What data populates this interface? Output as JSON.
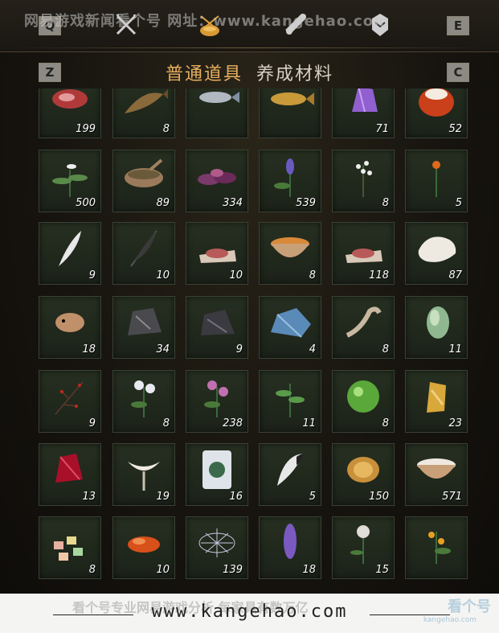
{
  "header": {
    "watermark": "网易游戏新闻看个号 网址：www.kangehao.com",
    "key_left": "Q",
    "key_right": "E",
    "key_sub_left": "Z",
    "key_sub_right": "C",
    "tabs": [
      {
        "icon": "crossed-swords-icon"
      },
      {
        "icon": "bag-icon",
        "active": true
      },
      {
        "icon": "scroll-icon"
      },
      {
        "icon": "badge-icon"
      }
    ]
  },
  "subtabs": [
    {
      "label": "普通道具",
      "active": true
    },
    {
      "label": "养成材料",
      "active": false
    }
  ],
  "items": [
    {
      "icon": "meat-icon",
      "qty": "199"
    },
    {
      "icon": "fish-brown-icon",
      "qty": "8"
    },
    {
      "icon": "fish-silver-icon",
      "qty": ""
    },
    {
      "icon": "fish-gold-icon",
      "qty": ""
    },
    {
      "icon": "amethyst-icon",
      "qty": "71"
    },
    {
      "icon": "amber-orange-icon",
      "qty": "52"
    },
    {
      "icon": "herb-white-flower-icon",
      "qty": "500"
    },
    {
      "icon": "mortar-icon",
      "qty": "89"
    },
    {
      "icon": "purple-leaf-icon",
      "qty": "334"
    },
    {
      "icon": "lavender-icon",
      "qty": "539"
    },
    {
      "icon": "baby-breath-icon",
      "qty": "8"
    },
    {
      "icon": "orange-flower-icon",
      "qty": "5"
    },
    {
      "icon": "feather-icon",
      "qty": "9"
    },
    {
      "icon": "dark-feather-icon",
      "qty": "10"
    },
    {
      "icon": "raw-meat-icon",
      "qty": "10"
    },
    {
      "icon": "broth-bowl-icon",
      "qty": "8"
    },
    {
      "icon": "raw-meat-icon",
      "qty": "118"
    },
    {
      "icon": "fur-pelt-icon",
      "qty": "87"
    },
    {
      "icon": "pufferfish-icon",
      "qty": "18"
    },
    {
      "icon": "iron-ore-icon",
      "qty": "34"
    },
    {
      "icon": "dark-ore-icon",
      "qty": "9"
    },
    {
      "icon": "blue-crystal-icon",
      "qty": "4"
    },
    {
      "icon": "bone-icon",
      "qty": "8"
    },
    {
      "icon": "melon-icon",
      "qty": "11"
    },
    {
      "icon": "red-berry-branch-icon",
      "qty": "9"
    },
    {
      "icon": "white-chrysanthemum-icon",
      "qty": "8"
    },
    {
      "icon": "pink-flower-icon",
      "qty": "238"
    },
    {
      "icon": "green-herb-icon",
      "qty": "11"
    },
    {
      "icon": "green-orb-icon",
      "qty": "8"
    },
    {
      "icon": "gold-nugget-icon",
      "qty": "23"
    },
    {
      "icon": "red-crystal-icon",
      "qty": "13"
    },
    {
      "icon": "white-lily-icon",
      "qty": "19"
    },
    {
      "icon": "herb-card-icon",
      "qty": "16"
    },
    {
      "icon": "fox-tail-icon",
      "qty": "5"
    },
    {
      "icon": "gold-drum-icon",
      "qty": "150"
    },
    {
      "icon": "milk-bowl-icon",
      "qty": "571"
    },
    {
      "icon": "colored-stones-icon",
      "qty": "8"
    },
    {
      "icon": "orange-stone-icon",
      "qty": "10"
    },
    {
      "icon": "silver-mushroom-icon",
      "qty": "139"
    },
    {
      "icon": "purple-spike-icon",
      "qty": "18"
    },
    {
      "icon": "white-rose-icon",
      "qty": "15"
    },
    {
      "icon": "orange-blossom-icon",
      "qty": ""
    }
  ],
  "footer": {
    "url": "www.kangehao.com",
    "watermark": "看个号专业网易游戏分析 每家具有数万亿",
    "logo": "看个号",
    "logo_sub": "kangehao.com"
  },
  "colors": {
    "accent": "#e8b060",
    "slot_bg": "#263021",
    "text": "#d6d1c4"
  }
}
